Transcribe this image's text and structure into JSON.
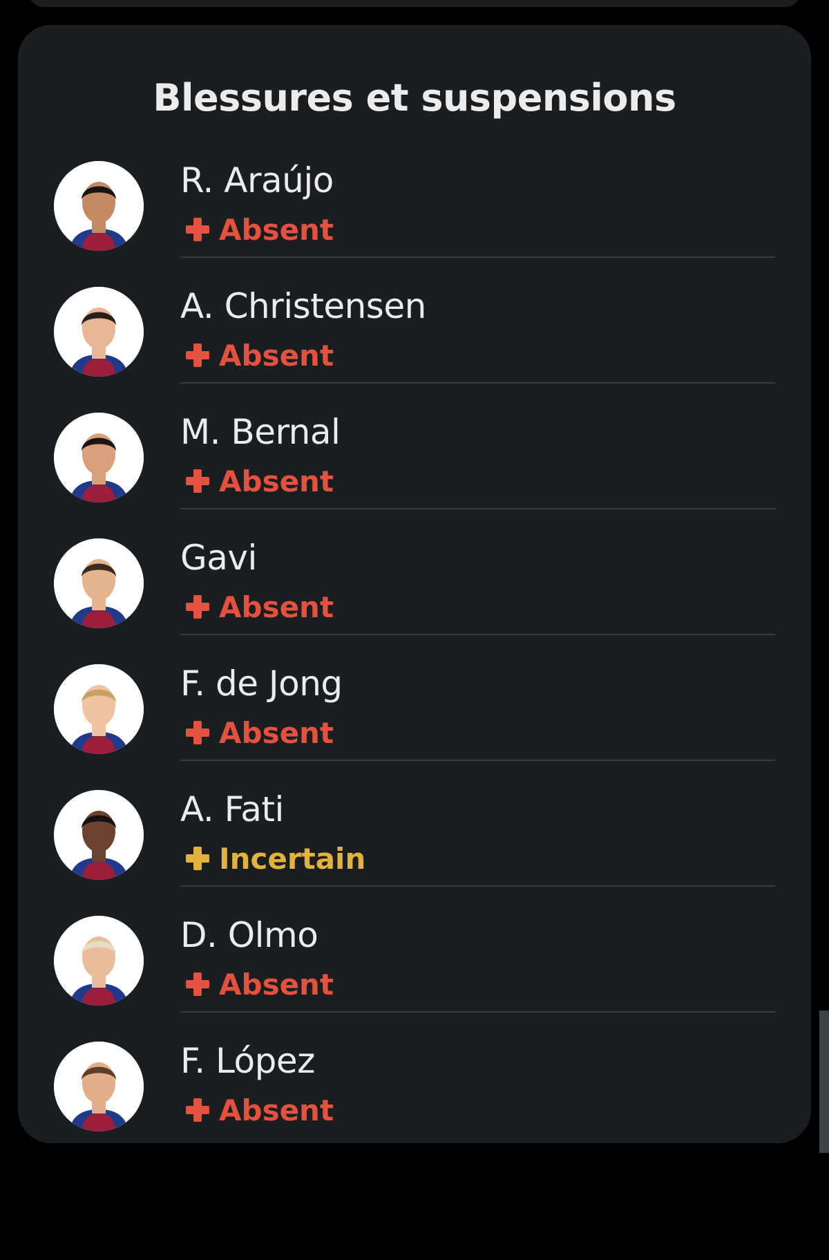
{
  "card": {
    "title": "Blessures et suspensions"
  },
  "colors": {
    "absent": "#e4513f",
    "uncertain": "#e2b23c",
    "card_bg": "#1b1e20",
    "text": "#ececec"
  },
  "players": [
    {
      "name": "R. Araújo",
      "status": "Absent",
      "status_type": "absent",
      "avatar_icon": "player-photo-icon"
    },
    {
      "name": "A. Christensen",
      "status": "Absent",
      "status_type": "absent",
      "avatar_icon": "player-photo-icon"
    },
    {
      "name": "M. Bernal",
      "status": "Absent",
      "status_type": "absent",
      "avatar_icon": "player-photo-icon"
    },
    {
      "name": "Gavi",
      "status": "Absent",
      "status_type": "absent",
      "avatar_icon": "player-photo-icon"
    },
    {
      "name": "F. de Jong",
      "status": "Absent",
      "status_type": "absent",
      "avatar_icon": "player-photo-icon"
    },
    {
      "name": "A. Fati",
      "status": "Incertain",
      "status_type": "uncertain",
      "avatar_icon": "player-photo-icon"
    },
    {
      "name": "D. Olmo",
      "status": "Absent",
      "status_type": "absent",
      "avatar_icon": "player-photo-icon"
    },
    {
      "name": "F. López",
      "status": "Absent",
      "status_type": "absent",
      "avatar_icon": "player-photo-icon"
    }
  ]
}
